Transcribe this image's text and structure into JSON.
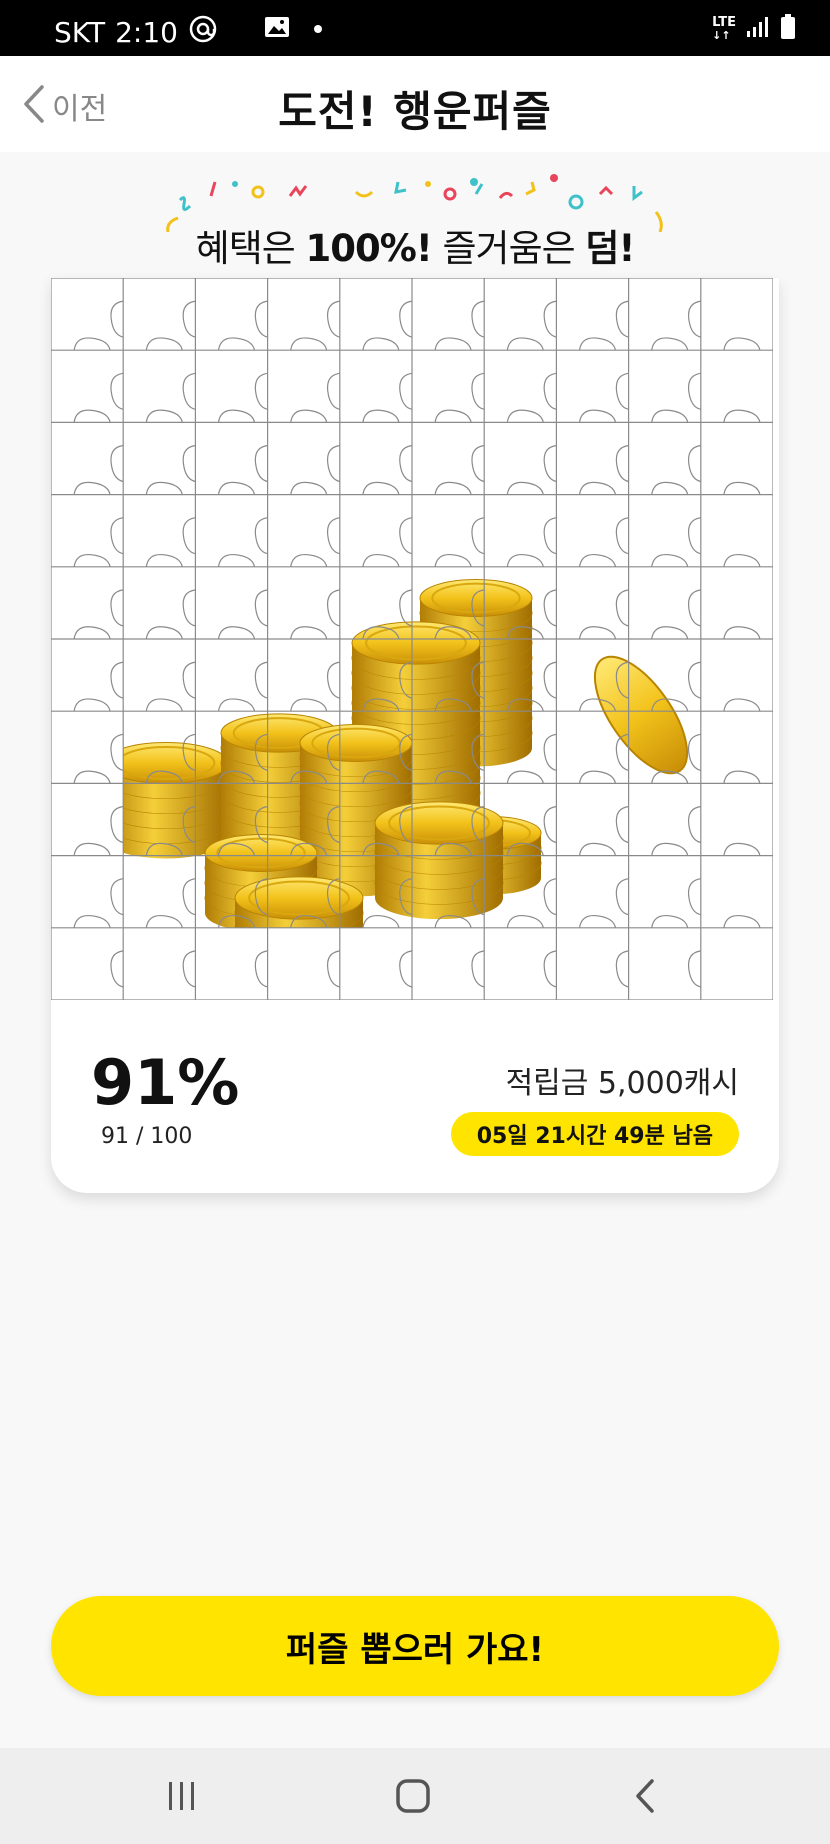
{
  "status_bar": {
    "carrier": "SKT",
    "time": "2:10",
    "network": "LTE"
  },
  "header": {
    "back_label": "이전",
    "title": "도전! 행운퍼즐"
  },
  "banner": {
    "text_1": "혜택은 ",
    "text_2": "100%!",
    "text_3": " 즐거움은 ",
    "text_4": "덤!"
  },
  "puzzle": {
    "total_pieces": 100,
    "revealed_pieces": 91,
    "image": "gold-coins-stack"
  },
  "progress": {
    "percent": "91%",
    "count": "91 / 100"
  },
  "reward": {
    "label": "적립금 5,000캐시",
    "remaining_time": "05일 21시간 49분 남음"
  },
  "cta": {
    "label": "퍼즐 뽑으러 가요!"
  },
  "colors": {
    "accent": "#ffe400",
    "coin_gold": "#f2c21a"
  }
}
